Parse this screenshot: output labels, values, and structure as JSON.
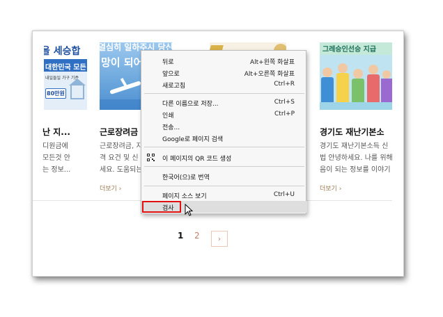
{
  "cards": [
    {
      "title": "난 지...",
      "desc": [
        "디원금에",
        "모든것 안",
        "는 정보..."
      ],
      "thumb_top": "을 세승합",
      "thumb_band": "대한민국 모든",
      "thumb_small": "내일들일 가구 기준",
      "thumb_badge": "80만원"
    },
    {
      "title": "근로장려금",
      "desc": [
        "근로장려금, 지",
        "격 요건 및 신",
        "세요. 도움되는"
      ],
      "thumb_top": "열심히 일하주시 당신께",
      "thumb_mid": "망이 되어"
    },
    {
      "title": "",
      "desc": []
    },
    {
      "title": "경기도 재난기본소",
      "desc": [
        "경기도 재난기본소득 신",
        "법 안녕하세요. 나를 위해",
        "음이 되는 정보를 이야기"
      ],
      "thumb_top": "그레승인선승 지급"
    }
  ],
  "more_label": "더보기",
  "more_arrow": "›",
  "pagination": {
    "pages": [
      "1",
      "2"
    ],
    "next": "›"
  },
  "context_menu": {
    "items": [
      {
        "label": "뒤로",
        "shortcut": "Alt+왼쪽 화살표"
      },
      {
        "label": "앞으로",
        "shortcut": "Alt+오른쪽 화살표"
      },
      {
        "label": "새로고침",
        "shortcut": "Ctrl+R"
      },
      {
        "label": "다른 이름으로 저장...",
        "shortcut": "Ctrl+S"
      },
      {
        "label": "인쇄",
        "shortcut": "Ctrl+P"
      },
      {
        "label": "전송...",
        "shortcut": ""
      },
      {
        "label": "Google로 페이지 검색",
        "shortcut": ""
      },
      {
        "label": "이 페이지의 QR 코드 생성",
        "shortcut": "",
        "icon": "qr-code-icon"
      },
      {
        "label": "한국어(으)로 번역",
        "shortcut": ""
      },
      {
        "label": "페이지 소스 보기",
        "shortcut": "Ctrl+U"
      },
      {
        "label": "검사",
        "shortcut": "",
        "highlighted": true
      }
    ]
  },
  "colors": {
    "accent_more": "#9a7a50",
    "inspect_outline": "#e01010",
    "menu_bg": "#f7f7f7"
  }
}
